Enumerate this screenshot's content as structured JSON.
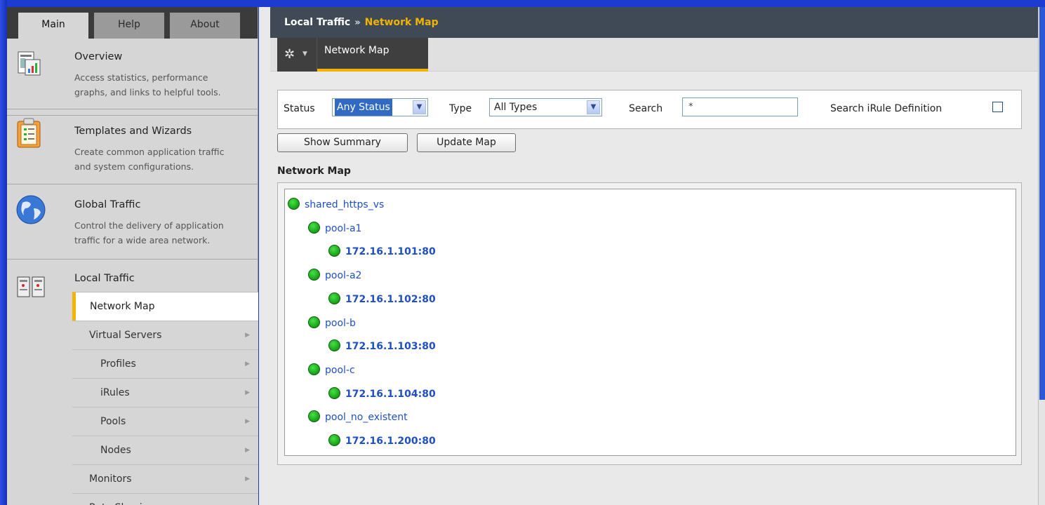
{
  "sidebar": {
    "tabs": [
      {
        "label": "Main",
        "active": true
      },
      {
        "label": "Help",
        "active": false
      },
      {
        "label": "About",
        "active": false
      }
    ],
    "sections": {
      "overview": {
        "title": "Overview",
        "desc1": "Access statistics, performance",
        "desc2": "graphs, and links to helpful tools.",
        "icon": "overview-report-icon"
      },
      "templates": {
        "title": "Templates and Wizards",
        "desc1": "Create common application traffic",
        "desc2": "and system configurations.",
        "icon": "clipboard-icon"
      },
      "global": {
        "title": "Global Traffic",
        "desc1": "Control the delivery of application",
        "desc2": "traffic for a wide area network.",
        "icon": "globe-icon"
      },
      "local": {
        "title": "Local Traffic",
        "icon": "servers-icon"
      }
    },
    "local_items": [
      {
        "label": "Network Map",
        "active": true,
        "arrow": false
      },
      {
        "label": "Virtual Servers",
        "arrow": true
      },
      {
        "label": "Profiles",
        "arrow": true
      },
      {
        "label": "iRules",
        "arrow": true
      },
      {
        "label": "Pools",
        "arrow": true
      },
      {
        "label": "Nodes",
        "arrow": true
      },
      {
        "label": "Monitors",
        "arrow": true
      },
      {
        "label": "Rate Shaping",
        "arrow": true
      }
    ]
  },
  "breadcrumb": {
    "parent": "Local Traffic",
    "separator": "»",
    "current": "Network Map"
  },
  "subnav": {
    "tab": "Network Map"
  },
  "filters": {
    "status_label": "Status",
    "status_value": "Any Status",
    "type_label": "Type",
    "type_value": "All Types",
    "search_label": "Search",
    "search_value": "*",
    "irule_label": "Search iRule Definition"
  },
  "buttons": {
    "show_summary": "Show Summary",
    "update_map": "Update Map"
  },
  "map": {
    "heading": "Network Map",
    "nodes": [
      {
        "label": "shared_https_vs",
        "level": 0,
        "status": "green"
      },
      {
        "label": "pool-a1",
        "level": 1,
        "status": "green"
      },
      {
        "label": "172.16.1.101:80",
        "level": 2,
        "status": "green"
      },
      {
        "label": "pool-a2",
        "level": 1,
        "status": "green"
      },
      {
        "label": "172.16.1.102:80",
        "level": 2,
        "status": "green"
      },
      {
        "label": "pool-b",
        "level": 1,
        "status": "green"
      },
      {
        "label": "172.16.1.103:80",
        "level": 2,
        "status": "green"
      },
      {
        "label": "pool-c",
        "level": 1,
        "status": "green"
      },
      {
        "label": "172.16.1.104:80",
        "level": 2,
        "status": "green"
      },
      {
        "label": "pool_no_existent",
        "level": 1,
        "status": "green"
      },
      {
        "label": "172.16.1.200:80",
        "level": 2,
        "status": "green"
      }
    ]
  },
  "colors": {
    "accent": "#f2b400",
    "header_bg": "#3f4a56",
    "link": "#1f4fc4",
    "status_green": "#22b022"
  }
}
